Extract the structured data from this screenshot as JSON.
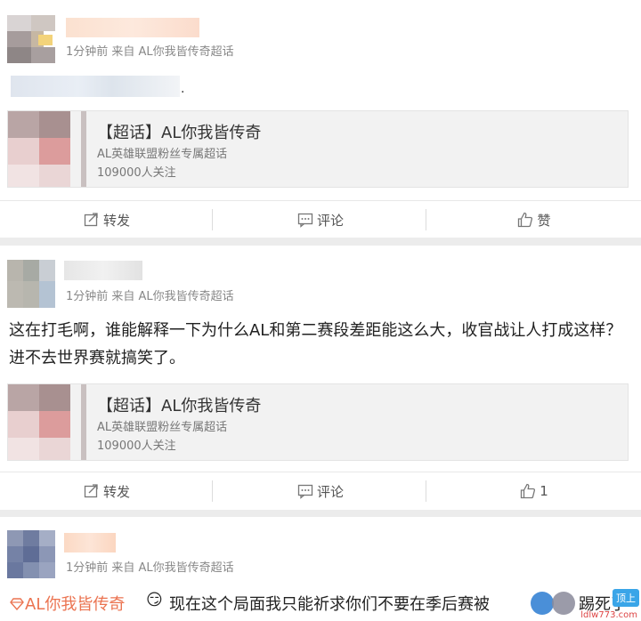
{
  "posts": [
    {
      "meta": "1分钟前 来自 AL你我皆传奇超话",
      "text": "",
      "card": {
        "title": "【超话】AL你我皆传奇",
        "subtitle": "AL英雄联盟粉丝专属超话",
        "followers": "109000人关注"
      },
      "actions": {
        "repost": "转发",
        "comment": "评论",
        "like": "赞"
      }
    },
    {
      "meta": "1分钟前 来自 AL你我皆传奇超话",
      "text": "这在打毛啊，谁能解释一下为什么AL和第二赛段差距能这么大，收官战让人打成这样？进不去世界赛就搞笑了。",
      "card": {
        "title": "【超话】AL你我皆传奇",
        "subtitle": "AL英雄联盟粉丝专属超话",
        "followers": "109000人关注"
      },
      "actions": {
        "repost": "转发",
        "comment": "评论",
        "like": "1"
      }
    },
    {
      "meta": "1分钟前 来自 AL你我皆传奇超话",
      "topic": "AL你我皆传奇",
      "emoji": "😏",
      "text": "现在这个局面我只能祈求你们不要在季后赛被",
      "text_tail": "踢死了"
    }
  ],
  "overlay": {
    "top_label": "顶上",
    "watermark": "ldlw773.com"
  },
  "colors": {
    "link": "#eb7350",
    "meta": "#888888",
    "card_bg": "#f2f2f2"
  },
  "icons": {
    "repost": "share-icon",
    "comment": "comment-icon",
    "like": "thumbs-up-icon",
    "topic": "diamond-topic-icon"
  }
}
